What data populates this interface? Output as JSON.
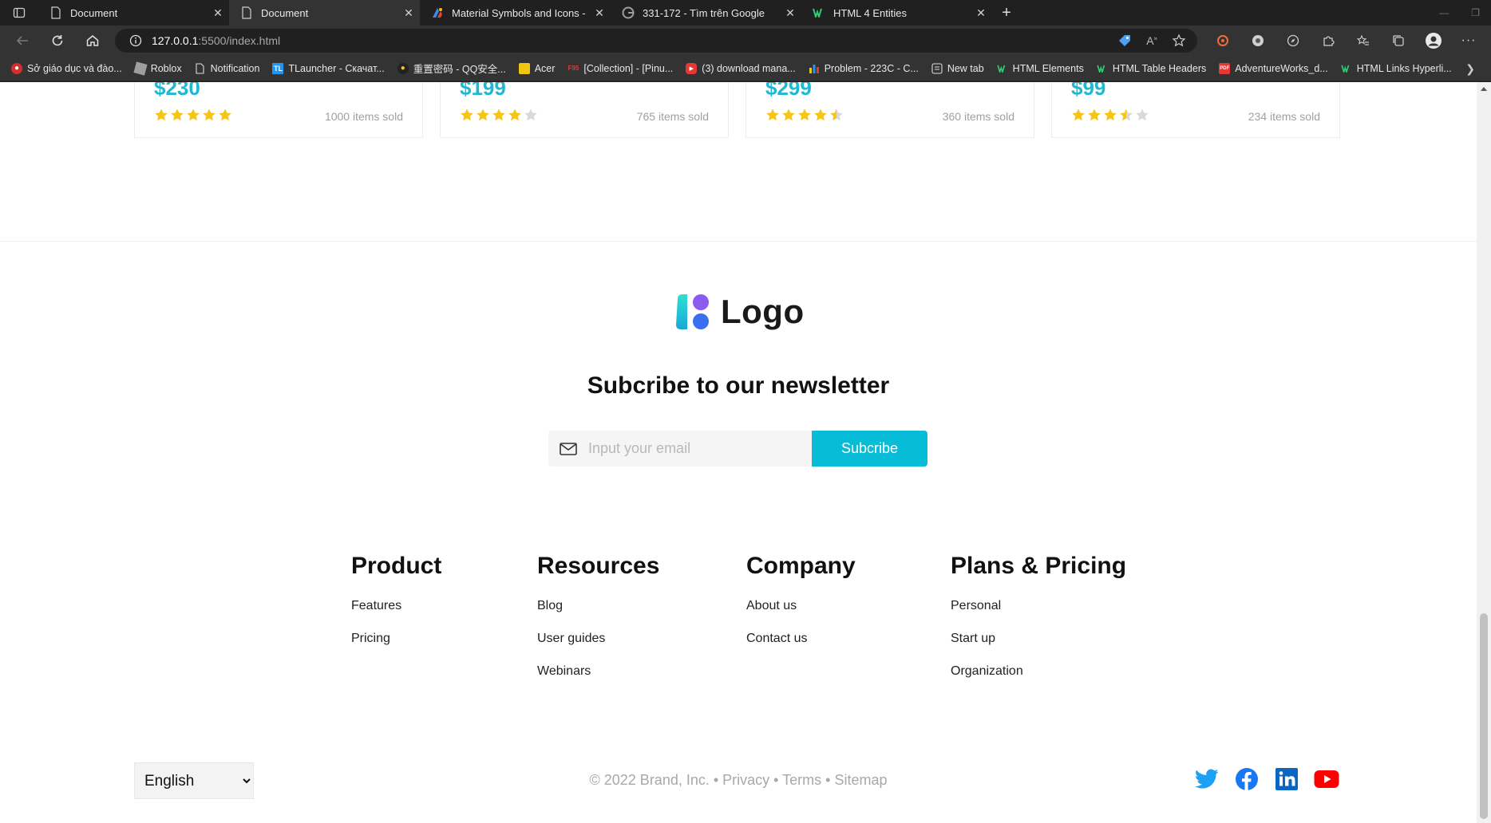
{
  "browser": {
    "tabs": [
      {
        "title": "Document",
        "favicon": "page-icon",
        "active": false
      },
      {
        "title": "Document",
        "favicon": "page-icon",
        "active": true
      },
      {
        "title": "Material Symbols and Icons - Go",
        "favicon": "google-fonts-icon",
        "active": false
      },
      {
        "title": "331-172 - Tìm trên Google",
        "favicon": "google-icon",
        "active": false
      },
      {
        "title": "HTML 4 Entities",
        "favicon": "w3-icon",
        "active": false
      }
    ],
    "address": {
      "host": "127.0.0.1",
      "path": ":5500/index.html"
    },
    "bookmarks": [
      {
        "label": "Sở giáo dục và đào...",
        "icon": "school-icon"
      },
      {
        "label": "Roblox",
        "icon": "roblox-icon"
      },
      {
        "label": "Notification",
        "icon": "page-icon"
      },
      {
        "label": "TLauncher - Скачат...",
        "icon": "tlauncher-icon"
      },
      {
        "label": "重置密码 - QQ安全...",
        "icon": "qq-icon"
      },
      {
        "label": "Acer",
        "icon": "folder-icon"
      },
      {
        "label": "[Collection] - [Pinu...",
        "icon": "f95-icon"
      },
      {
        "label": "(3) download mana...",
        "icon": "youtube-icon"
      },
      {
        "label": "Problem - 223C - C...",
        "icon": "codeforces-icon"
      },
      {
        "label": "New tab",
        "icon": "newtab-icon"
      },
      {
        "label": "HTML Elements",
        "icon": "w3-icon"
      },
      {
        "label": "HTML Table Headers",
        "icon": "w3-icon"
      },
      {
        "label": "AdventureWorks_d...",
        "icon": "pdf-icon"
      },
      {
        "label": "HTML Links Hyperli...",
        "icon": "w3-icon"
      }
    ]
  },
  "products": [
    {
      "price": "$230",
      "rating": 5,
      "sold": "1000 items sold"
    },
    {
      "price": "$199",
      "rating": 4,
      "sold": "765 items sold"
    },
    {
      "price": "$299",
      "rating": 4.5,
      "sold": "360 items sold"
    },
    {
      "price": "$99",
      "rating": 3.5,
      "sold": "234 items sold"
    }
  ],
  "footer": {
    "logo_text": "Logo",
    "newsletter_title": "Subcribe to our newsletter",
    "email_placeholder": "Input your email",
    "subscribe_label": "Subcribe",
    "columns": [
      {
        "title": "Product",
        "links": [
          "Features",
          "Pricing"
        ]
      },
      {
        "title": "Resources",
        "links": [
          "Blog",
          "User guides",
          "Webinars"
        ]
      },
      {
        "title": "Company",
        "links": [
          "About us",
          "Contact us"
        ]
      },
      {
        "title": "Plans & Pricing",
        "links": [
          "Personal",
          "Start up",
          "Organization"
        ]
      }
    ],
    "language": "English",
    "copyright": "© 2022 Brand, Inc. • Privacy • Terms • Sitemap",
    "socials": [
      "twitter-icon",
      "facebook-icon",
      "linkedin-icon",
      "youtube-icon"
    ]
  },
  "colors": {
    "accent": "#06bcd6",
    "price": "#1fb8d3",
    "star": "#f5c518",
    "star_empty": "#d9d9d9"
  }
}
